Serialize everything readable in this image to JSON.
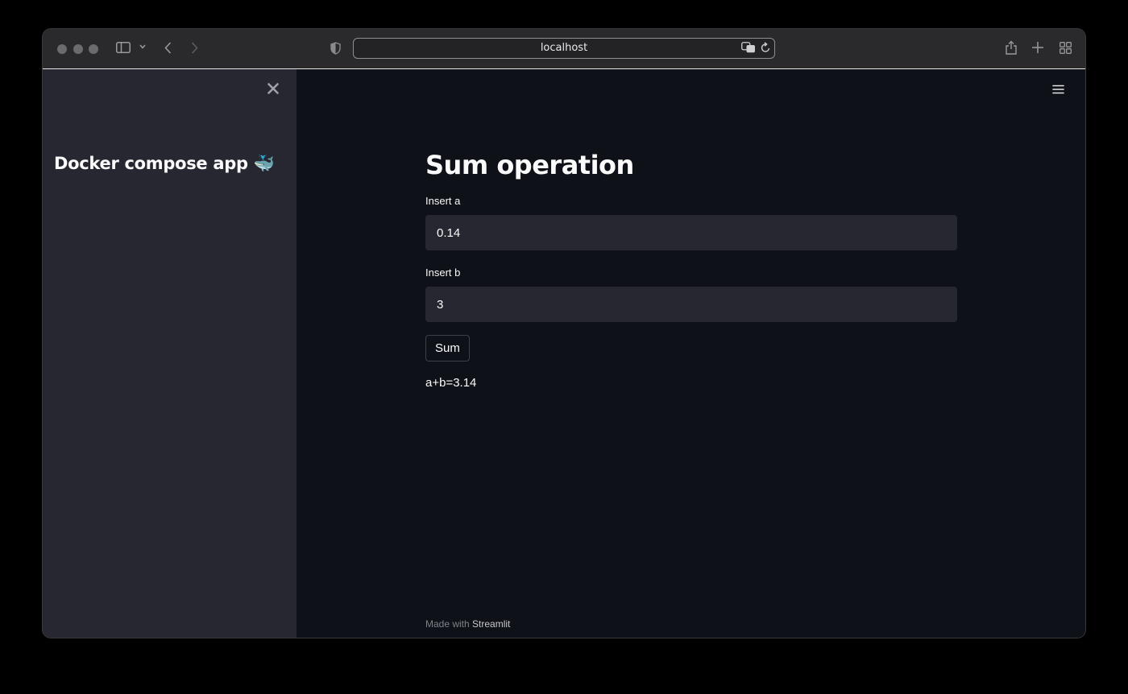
{
  "browser": {
    "url": "localhost"
  },
  "sidebar": {
    "title": "Docker compose app 🐳"
  },
  "main": {
    "title": "Sum operation",
    "field_a": {
      "label": "Insert a",
      "value": "0.14"
    },
    "field_b": {
      "label": "Insert b",
      "value": "3"
    },
    "button_label": "Sum",
    "result": "a+b=3.14"
  },
  "footer": {
    "prefix": "Made with ",
    "link": "Streamlit"
  },
  "colors": {
    "background": "#0e1117",
    "sidebar": "#262730",
    "input": "#262730",
    "text": "#fafafa"
  },
  "icons": [
    "sidebar-toggle-icon",
    "chevron-down-icon",
    "back-icon",
    "forward-icon",
    "shield-icon",
    "translate-icon",
    "reload-icon",
    "share-icon",
    "new-tab-icon",
    "tab-overview-icon",
    "close-icon",
    "hamburger-menu-icon"
  ]
}
